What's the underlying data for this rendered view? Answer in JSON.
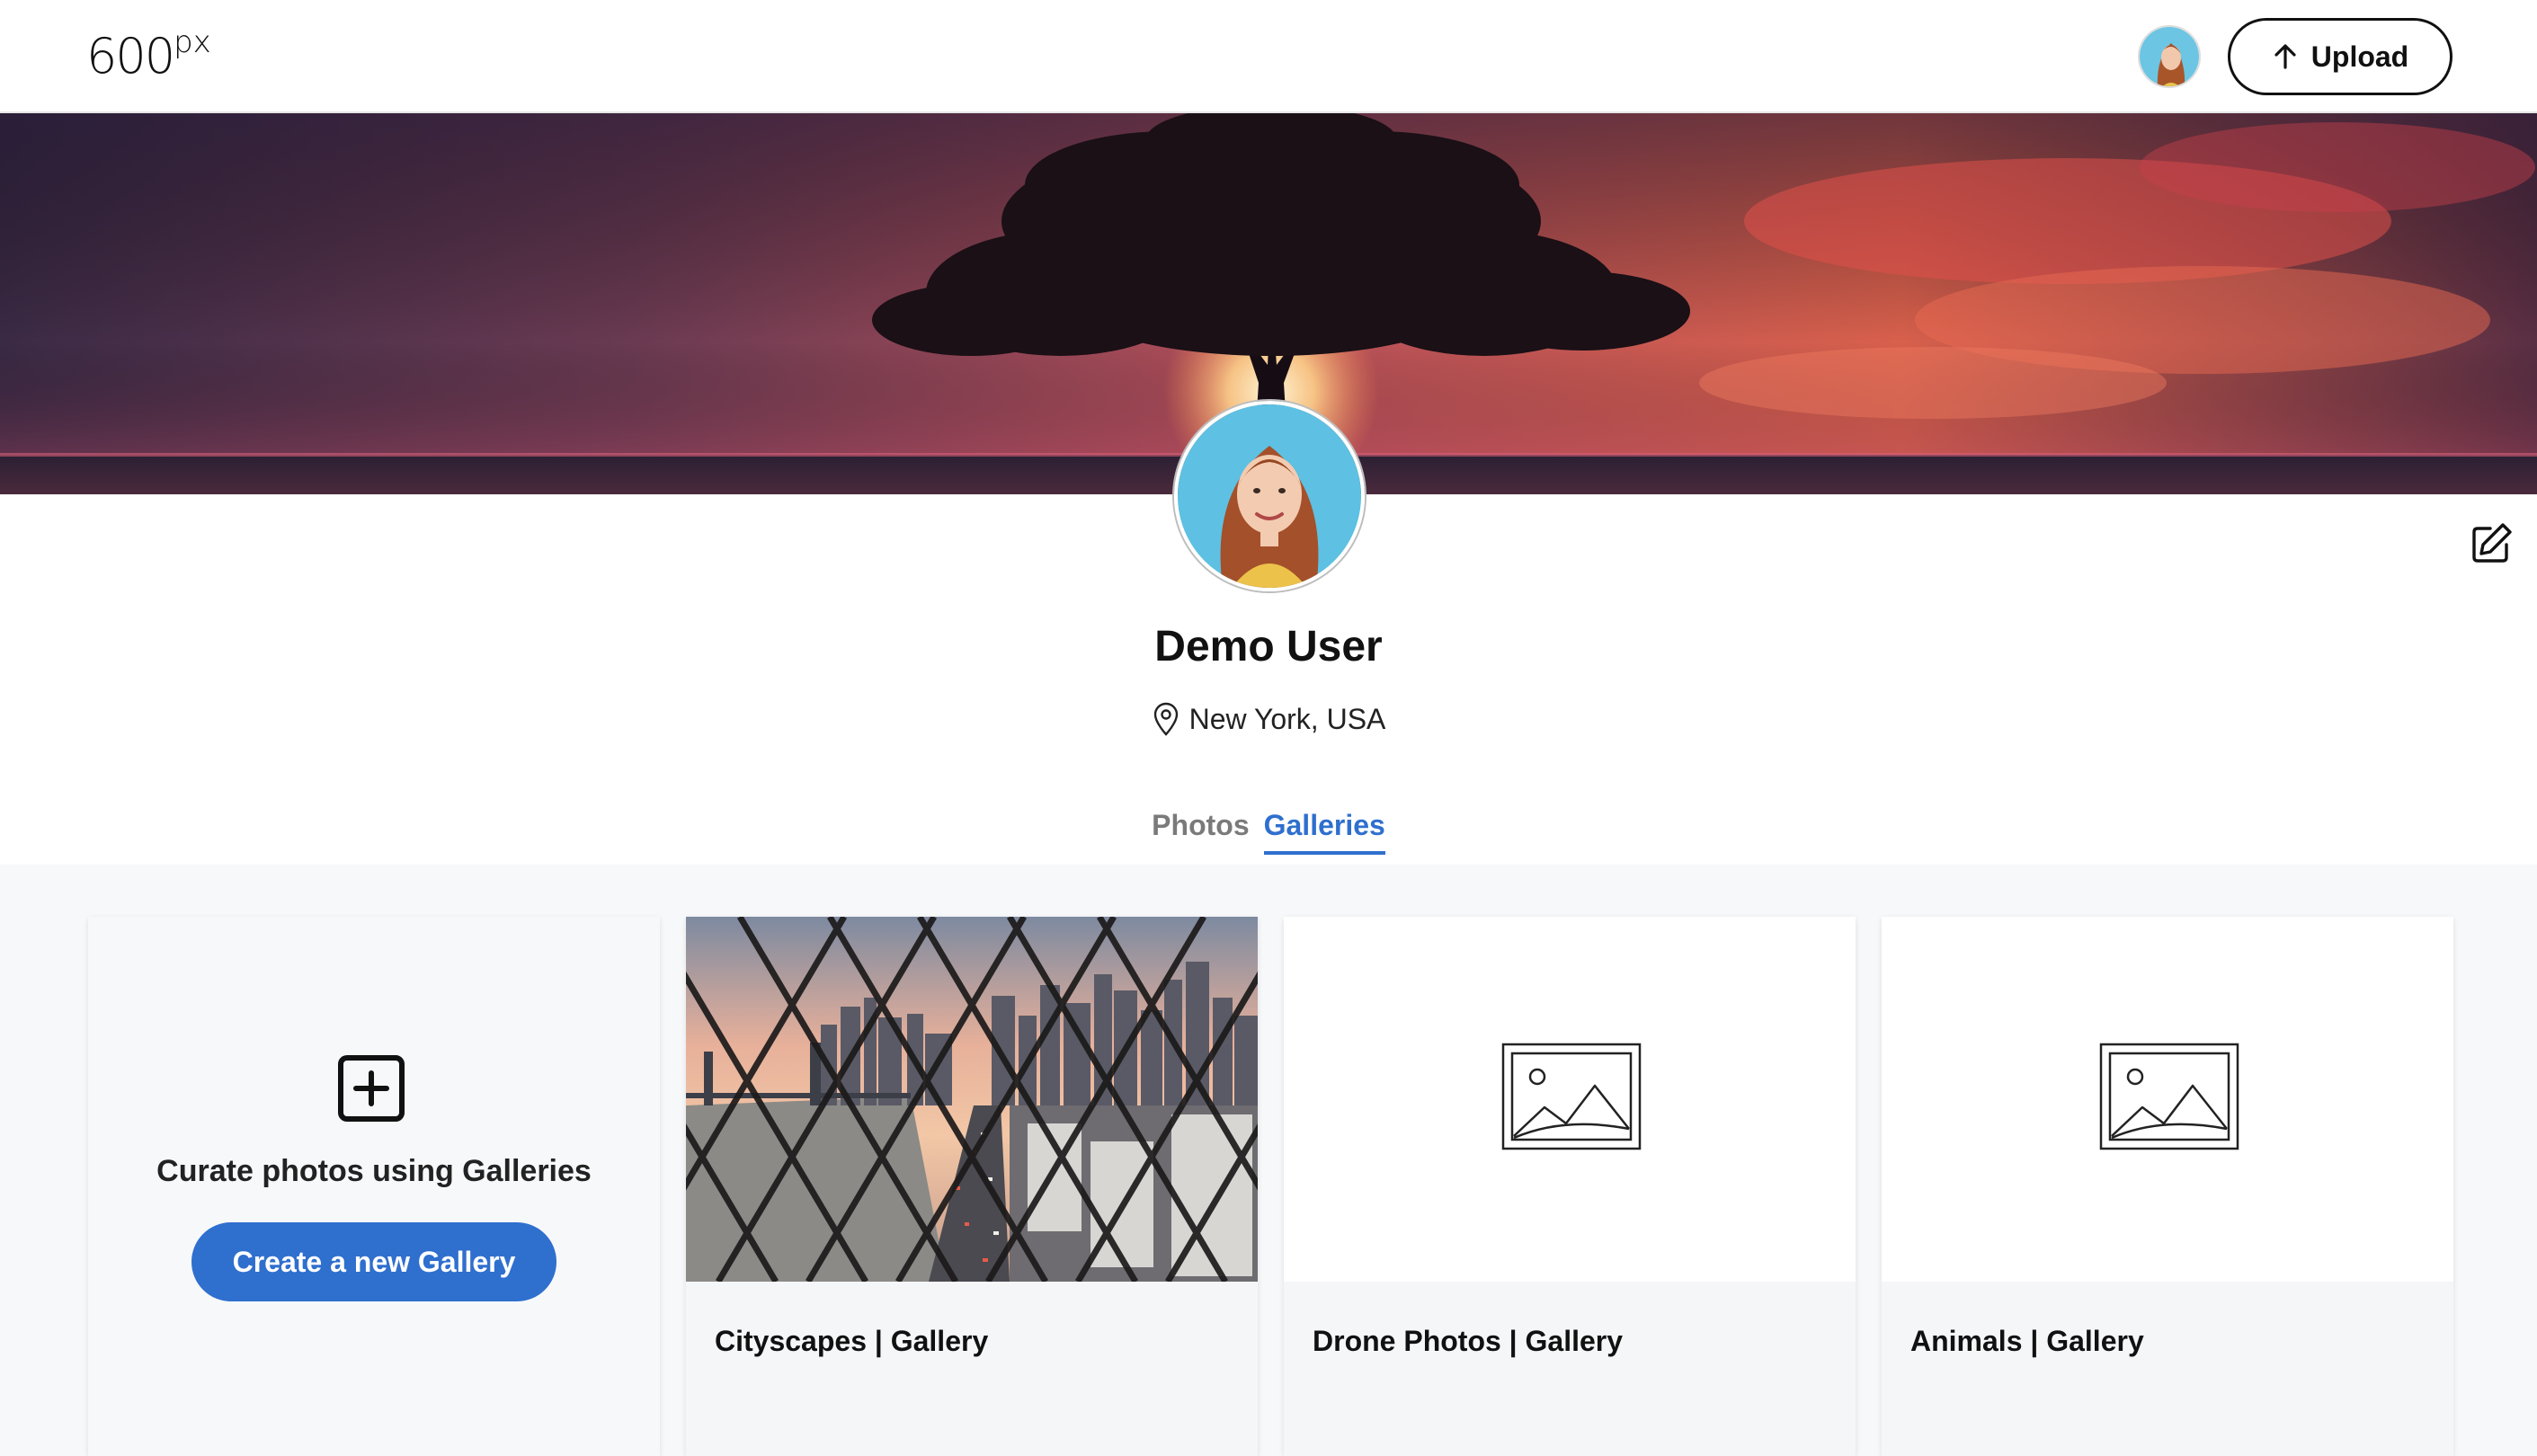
{
  "header": {
    "logo_main": "600",
    "logo_sup": "px",
    "upload_label": "Upload"
  },
  "profile": {
    "name": "Demo User",
    "location": "New York, USA"
  },
  "tabs": [
    {
      "label": "Photos",
      "active": false
    },
    {
      "label": "Galleries",
      "active": true
    }
  ],
  "create_card": {
    "text": "Curate photos using Galleries",
    "button_label": "Create a new Gallery"
  },
  "galleries": [
    {
      "title": "Cityscapes | Gallery",
      "has_cover": true
    },
    {
      "title": "Drone Photos | Gallery",
      "has_cover": false
    },
    {
      "title": "Animals | Gallery",
      "has_cover": false
    }
  ],
  "colors": {
    "accent": "#2f6fce",
    "background": "#f7f8fa"
  },
  "icons": {
    "upload": "arrow-up-icon",
    "edit": "edit-icon",
    "location": "map-pin-icon",
    "create": "plus-square-icon",
    "placeholder": "image-placeholder-icon"
  }
}
